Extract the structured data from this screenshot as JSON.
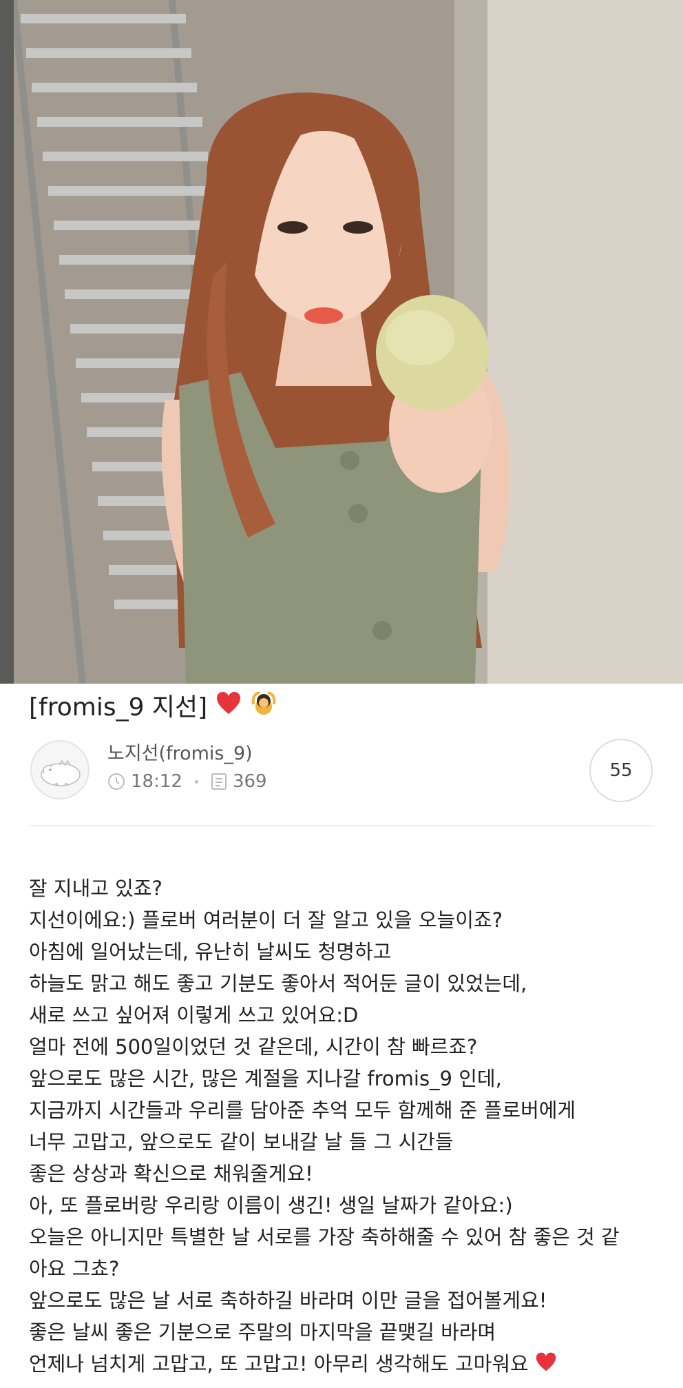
{
  "post": {
    "title": "[fromis_9 지선]",
    "title_emojis": [
      "heart-icon",
      "person-gesturing-ok-icon"
    ],
    "author": "노지선(fromis_9)",
    "time": "18:12",
    "views": "369",
    "comment_count": "55",
    "body_lines": [
      "잘 지내고 있죠?",
      "지선이에요:) 플로버 여러분이 더 잘 알고 있을 오늘이죠?",
      "아침에 일어났는데, 유난히 날씨도 청명하고",
      "하늘도 맑고 해도 좋고 기분도 좋아서 적어둔 글이 있었는데,",
      "새로 쓰고 싶어져 이렇게 쓰고 있어요:D",
      "얼마 전에 500일이었던 것 같은데, 시간이 참 빠르죠?",
      "앞으로도 많은 시간, 많은 계절을 지나갈 fromis_9 인데,",
      "지금까지 시간들과 우리를 담아준 추억 모두 함께해 준 플로버에게",
      "너무 고맙고, 앞으로도 같이 보내갈 날 들 그 시간들",
      "좋은 상상과 확신으로 채워줄게요!",
      "아, 또 플로버랑 우리랑 이름이 생긴! 생일 날짜가 같아요:)",
      "오늘은 아니지만 특별한 날 서로를 가장 축하해줄 수 있어 참 좋은 것 같",
      "아요 그쵸?",
      "앞으로도 많은 날 서로 축하하길 바라며 이만 글을 접어볼게요!",
      "좋은 날씨 좋은 기분으로 주말의 마지막을 끝맺길 바라며",
      "언제나 넘치게 고맙고, 또 고맙고! 아무리 생각해도 고마워요"
    ],
    "last_line_emoji": "heart-icon"
  },
  "colors": {
    "heart": "#e8323c",
    "dress": "#8f957a",
    "hair": "#9a5434",
    "muted_text": "#777777"
  }
}
